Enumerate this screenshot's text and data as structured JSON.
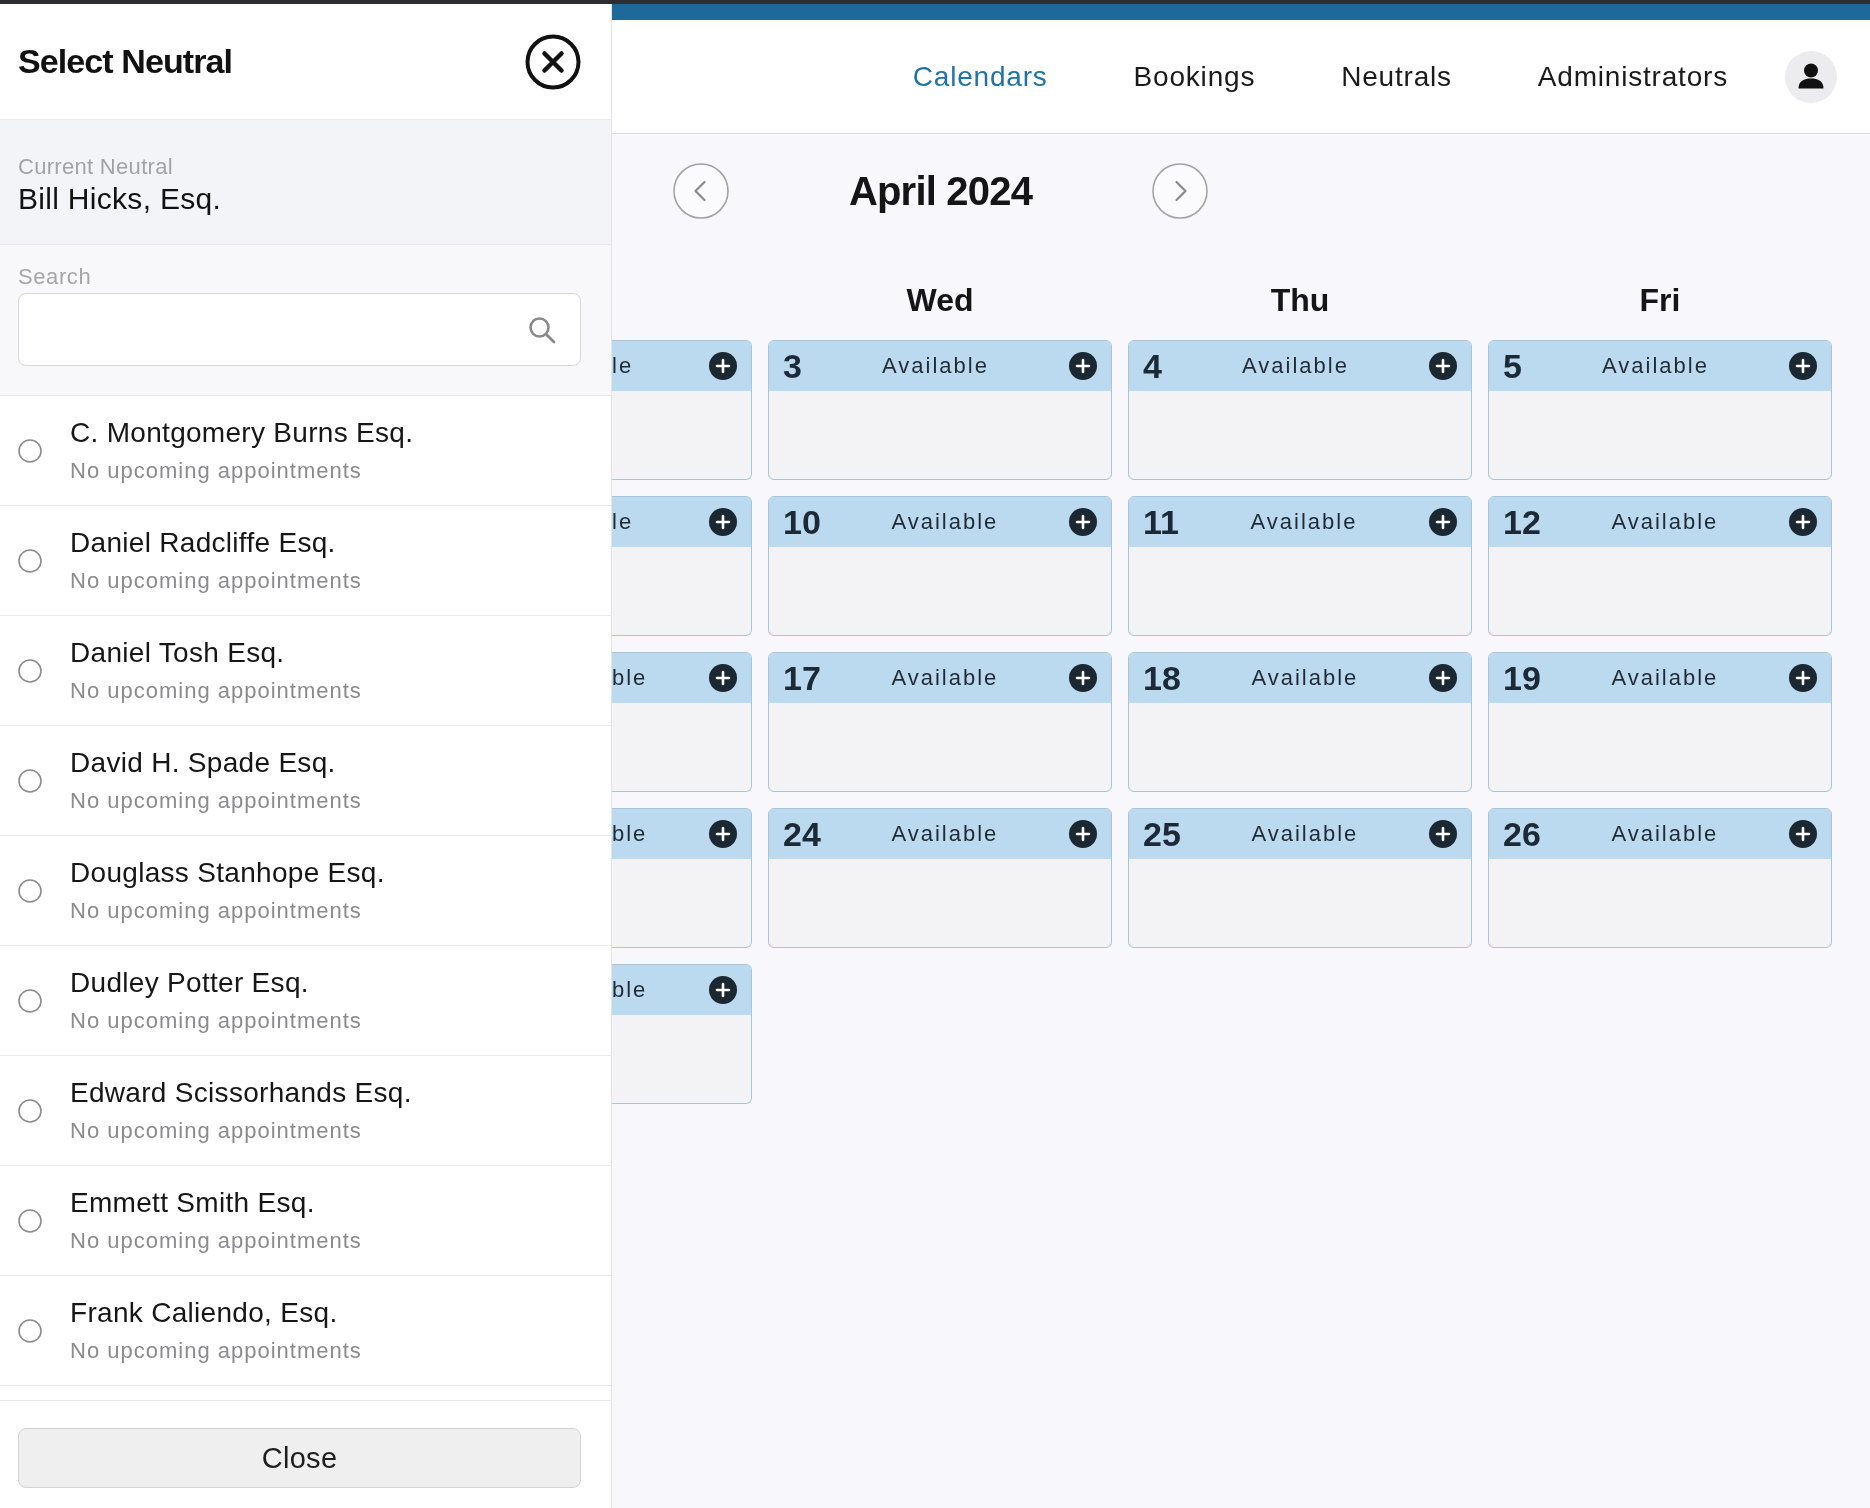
{
  "drawer": {
    "title": "Select Neutral",
    "current": {
      "label": "Current Neutral",
      "value": "Bill Hicks, Esq."
    },
    "search": {
      "label": "Search"
    },
    "neutrals": [
      {
        "name": "C. Montgomery Burns Esq.",
        "note": "No upcoming appointments",
        "selected": false
      },
      {
        "name": "Daniel Radcliffe Esq.",
        "note": "No upcoming appointments",
        "selected": false
      },
      {
        "name": "Daniel Tosh Esq.",
        "note": "No upcoming appointments",
        "selected": false
      },
      {
        "name": "David H. Spade Esq.",
        "note": "No upcoming appointments",
        "selected": false
      },
      {
        "name": "Douglass Stanhope Esq.",
        "note": "No upcoming appointments",
        "selected": false
      },
      {
        "name": "Dudley Potter Esq.",
        "note": "No upcoming appointments",
        "selected": false
      },
      {
        "name": "Edward Scissorhands Esq.",
        "note": "No upcoming appointments",
        "selected": false
      },
      {
        "name": "Emmett Smith Esq.",
        "note": "No upcoming appointments",
        "selected": false
      },
      {
        "name": "Frank Caliendo, Esq.",
        "note": "No upcoming appointments",
        "selected": false
      }
    ],
    "close_button": "Close"
  },
  "nav": {
    "items": [
      {
        "label": "Calendars",
        "selected": true
      },
      {
        "label": "Bookings",
        "selected": false
      },
      {
        "label": "Neutrals",
        "selected": false
      },
      {
        "label": "Administrators",
        "selected": false
      }
    ]
  },
  "calendar": {
    "month": "April 2024",
    "weekdays": [
      "Wed",
      "Thu",
      "Fri"
    ],
    "weeks": [
      {
        "days": [
          {
            "kind": "clipped",
            "status": "le"
          },
          {
            "kind": "day",
            "date": "3",
            "status": "Available"
          },
          {
            "kind": "day",
            "date": "4",
            "status": "Available"
          },
          {
            "kind": "day",
            "date": "5",
            "status": "Available"
          }
        ]
      },
      {
        "days": [
          {
            "kind": "clipped",
            "status": "le"
          },
          {
            "kind": "day",
            "date": "10",
            "status": "Available"
          },
          {
            "kind": "day",
            "date": "11",
            "status": "Available"
          },
          {
            "kind": "day",
            "date": "12",
            "status": "Available"
          }
        ]
      },
      {
        "days": [
          {
            "kind": "clipped",
            "status": "ble"
          },
          {
            "kind": "day",
            "date": "17",
            "status": "Available"
          },
          {
            "kind": "day",
            "date": "18",
            "status": "Available"
          },
          {
            "kind": "day",
            "date": "19",
            "status": "Available"
          }
        ]
      },
      {
        "days": [
          {
            "kind": "clipped",
            "status": "ble"
          },
          {
            "kind": "day",
            "date": "24",
            "status": "Available"
          },
          {
            "kind": "day",
            "date": "25",
            "status": "Available"
          },
          {
            "kind": "day",
            "date": "26",
            "status": "Available"
          }
        ]
      },
      {
        "days": [
          {
            "kind": "clipped",
            "status": "ble"
          }
        ]
      }
    ]
  }
}
